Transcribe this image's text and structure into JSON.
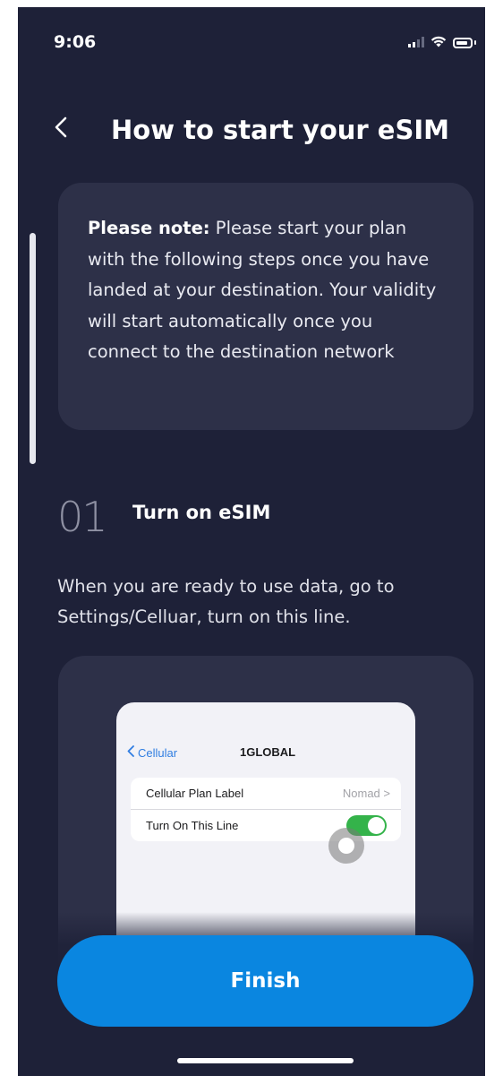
{
  "status_bar": {
    "time": "9:06",
    "icons": [
      "cellular-signal-icon",
      "wifi-icon",
      "battery-icon"
    ]
  },
  "header": {
    "back_icon": "chevron-left-icon",
    "title": "How to start your eSIM"
  },
  "note": {
    "label": "Please note:",
    "text": " Please start your plan with the following steps once you have landed at your destination. Your validity will start automatically once you connect to the destination network"
  },
  "steps": [
    {
      "number": "01",
      "title": "Turn on eSIM",
      "description": "When you are ready to use data, go to Settings/Celluar, turn on this line."
    }
  ],
  "illustration": {
    "back_label": "Cellular",
    "title": "1GLOBAL",
    "rows": [
      {
        "label": "Cellular Plan Label",
        "value": "Nomad >"
      },
      {
        "label": "Turn On This Line",
        "toggle_on": true
      }
    ]
  },
  "footer": {
    "finish_label": "Finish"
  },
  "colors": {
    "background": "#1e2138",
    "card": "#2d3048",
    "accent": "#0a86e0",
    "toggle_on": "#34b34a"
  }
}
